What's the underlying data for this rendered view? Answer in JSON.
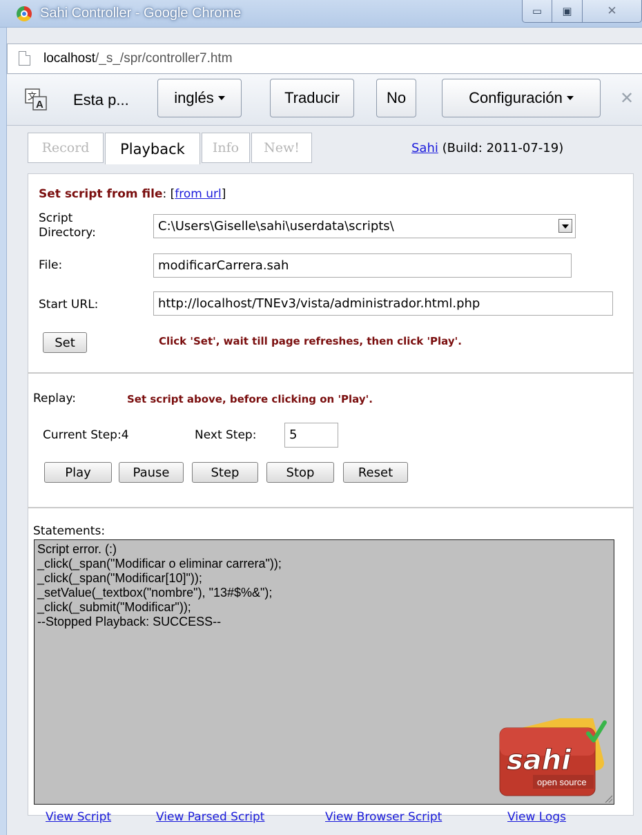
{
  "window": {
    "title": "Sahi Controller - Google Chrome",
    "min_glyph": "▭",
    "max_glyph": "▣",
    "close_glyph": "✕"
  },
  "address": {
    "host": "localhost",
    "path": "/_s_/spr/controller7.htm"
  },
  "translate_bar": {
    "message": "Esta p...",
    "language": "inglés",
    "translate": "Traducir",
    "no": "No",
    "settings": "Configuración",
    "close_glyph": "✕"
  },
  "tabs": [
    {
      "label": "Record",
      "active": false
    },
    {
      "label": "Playback",
      "active": true
    },
    {
      "label": "Info",
      "active": false
    },
    {
      "label": "New!",
      "active": false
    }
  ],
  "build": {
    "link": "Sahi",
    "text": " (Build: 2011-07-19)"
  },
  "set_section": {
    "heading": "Set script from file",
    "colon": ": ",
    "bracket_open": "[",
    "alt_link": "from url",
    "bracket_close": "]",
    "dir_label_1": "Script",
    "dir_label_2": "Directory:",
    "dir_value": "C:\\Users\\Giselle\\sahi\\userdata\\scripts\\",
    "file_label": "File:",
    "file_value": "modificarCarrera.sah",
    "url_label": "Start URL:",
    "url_value": "http://localhost/TNEv3/vista/administrador.html.php",
    "set_button": "Set",
    "hint": "Click 'Set', wait till page refreshes, then click 'Play'."
  },
  "replay": {
    "label": "Replay:",
    "hint": "Set script above, before clicking on 'Play'.",
    "current_step_label": "Current Step:",
    "current_step": "4",
    "next_step_label": "Next Step:",
    "next_step": "5",
    "buttons": {
      "play": "Play",
      "pause": "Pause",
      "step": "Step",
      "stop": "Stop",
      "reset": "Reset"
    }
  },
  "statements": {
    "label": "Statements:",
    "text": "Script error. (:)\n_click(_span(\"Modificar o eliminar carrera\"));\n_click(_span(\"Modificar[10]\"));\n_setValue(_textbox(\"nombre\"), \"13#$%&\");\n_click(_submit(\"Modificar\"));\n--Stopped Playback: SUCCESS--",
    "logo_text": "sahi",
    "logo_sub": "open source"
  },
  "links": {
    "view_script": "View Script",
    "view_parsed": "View Parsed Script",
    "view_browser": "View Browser Script",
    "view_logs": "View Logs"
  },
  "colors": {
    "hint_red": "#7a0e0e",
    "link_blue": "#1a1adb",
    "statements_bg": "#c0c0c0"
  }
}
